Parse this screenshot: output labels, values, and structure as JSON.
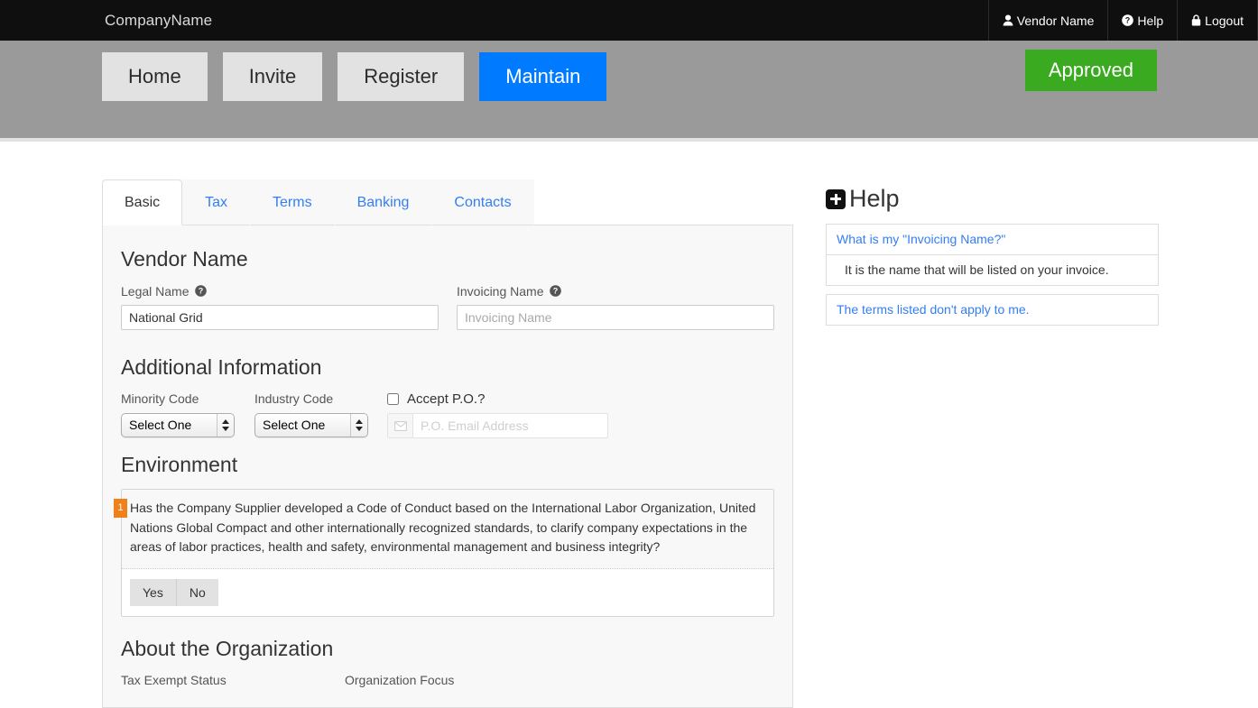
{
  "navbar": {
    "brand": "CompanyName",
    "items": [
      {
        "label": "Vendor Name",
        "icon": "user-icon"
      },
      {
        "label": "Help",
        "icon": "question-circle-icon"
      },
      {
        "label": "Logout",
        "icon": "lock-icon"
      }
    ]
  },
  "subheader": {
    "buttons": [
      {
        "label": "Home",
        "active": false
      },
      {
        "label": "Invite",
        "active": false
      },
      {
        "label": "Register",
        "active": false
      },
      {
        "label": "Maintain",
        "active": true
      }
    ],
    "status": "Approved",
    "status_color": "#3aaa20",
    "active_color": "#007bff"
  },
  "tabs": [
    {
      "label": "Basic",
      "active": true
    },
    {
      "label": "Tax",
      "active": false
    },
    {
      "label": "Terms",
      "active": false
    },
    {
      "label": "Banking",
      "active": false
    },
    {
      "label": "Contacts",
      "active": false
    }
  ],
  "form": {
    "vendor_name": {
      "heading": "Vendor Name",
      "legal_name_label": "Legal Name",
      "legal_name_value": "National Grid",
      "invoicing_name_label": "Invoicing Name",
      "invoicing_name_value": "",
      "invoicing_name_placeholder": "Invoicing Name"
    },
    "additional": {
      "heading": "Additional Information",
      "minority_label": "Minority Code",
      "minority_value": "Select One",
      "industry_label": "Industry Code",
      "industry_value": "Select One",
      "accept_po_label": "Accept P.O.?",
      "accept_po_checked": false,
      "po_email_value": "",
      "po_email_placeholder": "P.O. Email Address"
    },
    "environment": {
      "heading": "Environment",
      "question_number": "1",
      "question_badge_color": "#f0801a",
      "question": "Has the Company Supplier developed a Code of Conduct based on the International Labor Organization, United Nations Global Compact and other internationally recognized standards, to clarify company expectations in the areas of labor practices, health and safety, environmental management and business integrity?",
      "yes_label": "Yes",
      "no_label": "No"
    },
    "organization": {
      "heading": "About the Organization",
      "tax_exempt_label": "Tax Exempt Status",
      "org_focus_label": "Organization Focus"
    }
  },
  "help": {
    "heading": "Help",
    "items": [
      {
        "type": "link",
        "text": "What is my \"Invoicing Name?\""
      },
      {
        "type": "answer",
        "text": "It is the name that will be listed on your invoice."
      }
    ],
    "items2": [
      {
        "type": "link",
        "text": "The terms listed don't apply to me."
      }
    ]
  }
}
